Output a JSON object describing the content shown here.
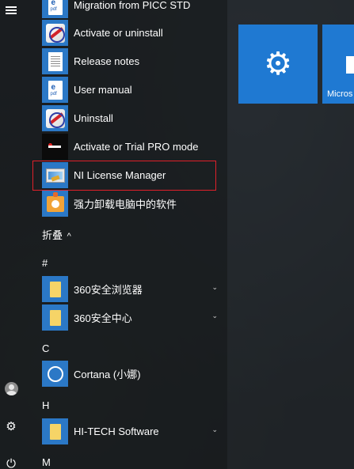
{
  "start_menu": {
    "apps": [
      {
        "label": "Migration from PICC STD",
        "icon": "pdf-document-icon"
      },
      {
        "label": "Activate or uninstall",
        "icon": "activation-key-icon"
      },
      {
        "label": "Release notes",
        "icon": "text-document-icon"
      },
      {
        "label": "User manual",
        "icon": "pdf-document-icon"
      },
      {
        "label": "Uninstall",
        "icon": "activation-key-icon"
      },
      {
        "label": "Activate or Trial PRO mode",
        "icon": "trial-mode-icon"
      },
      {
        "label": "NI License Manager",
        "icon": "license-manager-icon"
      },
      {
        "label": "强力卸载电脑中的软件",
        "icon": "uninstaller-icon"
      }
    ],
    "collapse_label": "折叠",
    "collapse_glyph": "^",
    "groups": [
      {
        "letter": "#",
        "apps": [
          {
            "label": "360安全浏览器",
            "icon": "folder-icon",
            "expandable": true
          },
          {
            "label": "360安全中心",
            "icon": "folder-icon",
            "expandable": true
          }
        ]
      },
      {
        "letter": "C",
        "apps": [
          {
            "label": "Cortana (小娜)",
            "icon": "cortana-icon",
            "expandable": false
          }
        ]
      },
      {
        "letter": "H",
        "apps": [
          {
            "label": "HI-TECH Software",
            "icon": "folder-icon",
            "expandable": true
          }
        ]
      },
      {
        "letter": "M",
        "apps": []
      }
    ],
    "highlighted_app": "NI License Manager",
    "highlight_color": "#e0202a"
  },
  "rail": {
    "menu_icon": "hamburger-icon",
    "account_icon": "user-avatar-icon",
    "settings_icon": "gear-icon",
    "power_icon": "power-icon",
    "settings_glyph": "⚙",
    "power_glyph": "⏻"
  },
  "tiles": [
    {
      "label": "",
      "icon": "gear-icon",
      "glyph": "⚙",
      "color": "#1f79d2"
    },
    {
      "label": "Micros",
      "icon": "store-bag-icon",
      "color": "#1f79d2"
    }
  ],
  "colors": {
    "accent": "#1f79d2",
    "icon_bg": "#2b78c6"
  }
}
